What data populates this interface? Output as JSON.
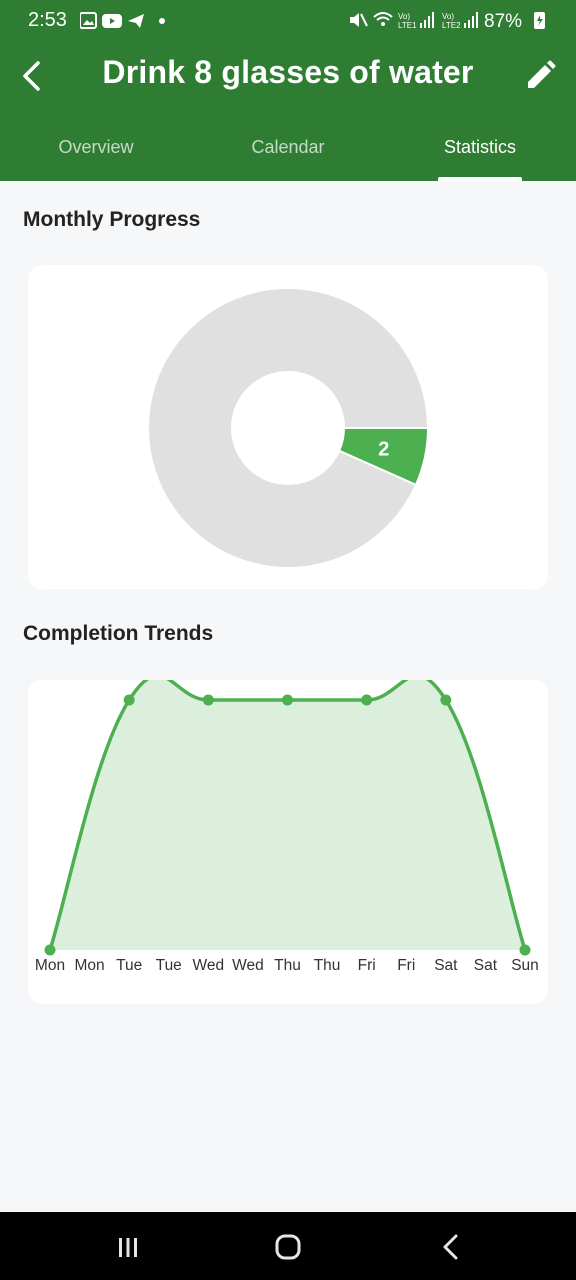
{
  "status_bar": {
    "time": "2:53",
    "battery": "87%",
    "sim1_label": "Vo) LTE1",
    "sim2_label": "Vo) LTE2"
  },
  "header": {
    "title": "Drink 8 glasses of water",
    "background_color": "#2e7d32"
  },
  "tabs": [
    {
      "label": "Overview",
      "active": false
    },
    {
      "label": "Calendar",
      "active": false
    },
    {
      "label": "Statistics",
      "active": true
    }
  ],
  "sections": {
    "monthly_progress_title": "Monthly Progress",
    "completion_trends_title": "Completion Trends"
  },
  "chart_data": [
    {
      "type": "pie",
      "title": "",
      "donut": true,
      "slices": [
        {
          "value": 2,
          "label": "2",
          "color": "#4caf50"
        },
        {
          "value": 28,
          "label": "",
          "color": "#e0e0e0"
        }
      ]
    },
    {
      "type": "area",
      "title": "",
      "categories": [
        "Mon",
        "Mon",
        "Tue",
        "Tue",
        "Wed",
        "Wed",
        "Thu",
        "Thu",
        "Fri",
        "Fri",
        "Sat",
        "Sat",
        "Sun"
      ],
      "points": [
        {
          "x": 0,
          "y": 0
        },
        {
          "x": 2,
          "y": 1
        },
        {
          "x": 4,
          "y": 1
        },
        {
          "x": 6,
          "y": 1
        },
        {
          "x": 8,
          "y": 1
        },
        {
          "x": 10,
          "y": 1
        },
        {
          "x": 12,
          "y": 0
        }
      ],
      "ylim": [
        0,
        1
      ],
      "line_color": "#4caf50",
      "fill_color": "#dcefdc",
      "grid": false
    }
  ],
  "icons": {
    "back": "arrow-back-icon",
    "edit": "pencil-icon",
    "nav_recent": "recent-apps-icon",
    "nav_home": "home-icon",
    "nav_back": "nav-back-icon"
  }
}
